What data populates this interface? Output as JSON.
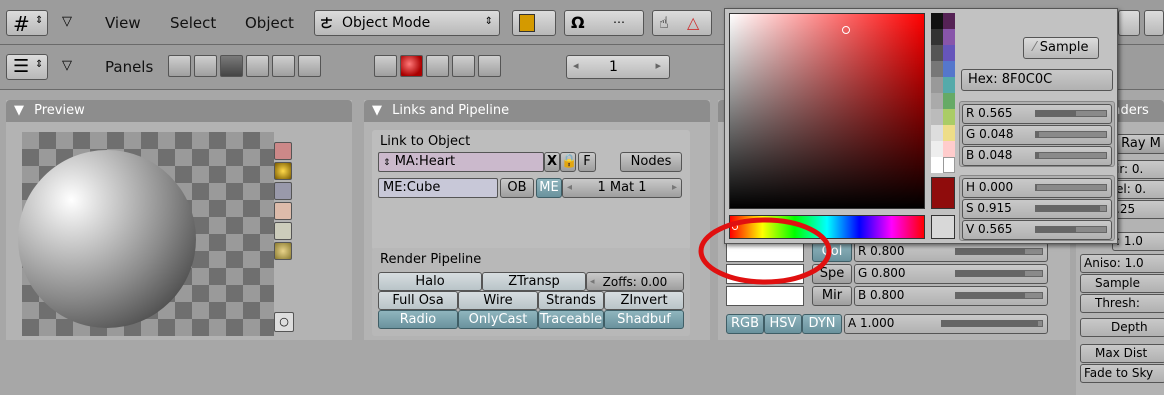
{
  "top_header": {
    "menu": [
      "View",
      "Select",
      "Object"
    ],
    "mode_label": "Object Mode"
  },
  "second_header": {
    "panels_label": "Panels",
    "frame_number": "1"
  },
  "preview_panel": {
    "title": "Preview"
  },
  "links_panel": {
    "title": "Links and Pipeline",
    "link_to_object": "Link to Object",
    "material_name": "MA:Heart",
    "x_label": "X",
    "f_label": "F",
    "nodes_label": "Nodes",
    "mesh_name": "ME:Cube",
    "ob_label": "OB",
    "me_label": "ME",
    "mat_label": "1 Mat 1",
    "render_pipeline": "Render Pipeline",
    "buttons_row1": [
      "Halo",
      "ZTransp",
      "Zoffs: 0.00"
    ],
    "buttons_row2": [
      "Full Osa",
      "Wire",
      "Strands",
      "ZInvert"
    ],
    "buttons_row3": [
      "Radio",
      "OnlyCast",
      "Traceable",
      "Shadbuf"
    ]
  },
  "color_picker": {
    "sample_label": "Sample",
    "hex_label": "Hex: 8F0C0C",
    "r_label": "R 0.565",
    "g_label": "G 0.048",
    "b_label": "B 0.048",
    "h_label": "H 0.000",
    "s_label": "S 0.915",
    "v_label": "V 0.565",
    "r_value": 0.565,
    "g_value": 0.048,
    "b_value": 0.048,
    "h_value": 0.0,
    "s_value": 0.915,
    "v_value": 0.565,
    "current_color": "#8F0C0C"
  },
  "material_panel": {
    "r_label": "R 0.800",
    "g_label": "G 0.800",
    "b_label": "B 0.800",
    "a_label": "A 1.000",
    "col_label": "Col",
    "spe_label": "Spe",
    "mir_label": "Mir",
    "mode_tabs": [
      "RGB",
      "HSV",
      "DYN"
    ]
  },
  "shaders_panel": {
    "title": "Shaders",
    "ray_label": "Ray M",
    "fields": [
      "ir: 0.",
      "el: 0.",
      ".25",
      ": 1.0"
    ],
    "aniso": "Aniso: 1.0",
    "samples": "Sample",
    "thresh": "Thresh:",
    "depth": "Depth",
    "max_dist": "Max Dist",
    "fade": "Fade to Sky"
  }
}
